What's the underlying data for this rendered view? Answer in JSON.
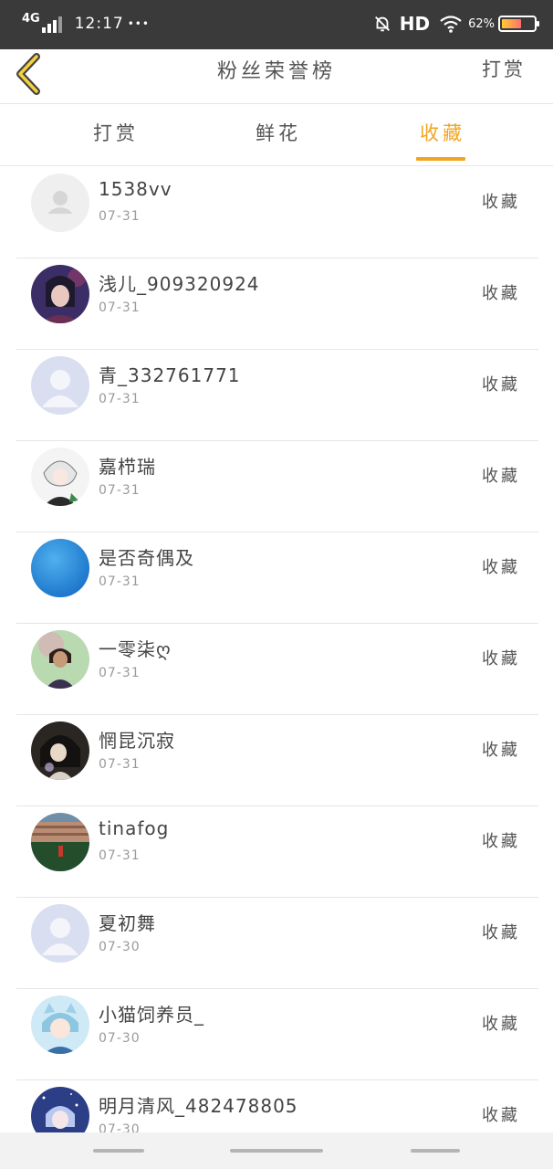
{
  "status_bar": {
    "network": "4G",
    "time": "12:17",
    "dots": "•••",
    "hd_label": "HD",
    "battery_percent": "62%",
    "battery_level": 0.62,
    "icons": [
      "signal-icon",
      "bell-off-icon",
      "wifi-icon",
      "battery-icon"
    ]
  },
  "header": {
    "back_icon": "chevron-left-icon",
    "title": "粉丝荣誉榜",
    "action_label": "打赏"
  },
  "tabs": [
    {
      "label": "打赏",
      "active": false
    },
    {
      "label": "鲜花",
      "active": false
    },
    {
      "label": "收藏",
      "active": true
    }
  ],
  "colors": {
    "accent": "#f0a522",
    "status_bar_bg": "#3a3a3a",
    "text": "#444444",
    "date_text": "#9a9a9a",
    "divider": "#e5e5e5"
  },
  "fans": [
    {
      "name": "1538vv",
      "date": "07-31",
      "tag": "收藏",
      "avatar": "default-gray-avatar"
    },
    {
      "name": "浅儿_909320924",
      "date": "07-31",
      "tag": "收藏",
      "avatar": "anime-girl-purple-avatar"
    },
    {
      "name": "青_332761771",
      "date": "07-31",
      "tag": "收藏",
      "avatar": "default-blue-avatar"
    },
    {
      "name": "嘉栉瑞",
      "date": "07-31",
      "tag": "收藏",
      "avatar": "anime-white-hair-avatar"
    },
    {
      "name": "是否奇偶及",
      "date": "07-31",
      "tag": "收藏",
      "avatar": "blue-circle-avatar"
    },
    {
      "name": "一零柒ღ",
      "date": "07-31",
      "tag": "收藏",
      "avatar": "anime-green-avatar"
    },
    {
      "name": "惘昆沉寂",
      "date": "07-31",
      "tag": "收藏",
      "avatar": "anime-dark-hair-avatar"
    },
    {
      "name": "tinafog",
      "date": "07-31",
      "tag": "收藏",
      "avatar": "building-photo-avatar"
    },
    {
      "name": "夏初舞",
      "date": "07-30",
      "tag": "收藏",
      "avatar": "default-blue-avatar"
    },
    {
      "name": "小猫饲养员_",
      "date": "07-30",
      "tag": "收藏",
      "avatar": "anime-cat-girl-avatar"
    },
    {
      "name": "明月清风_482478805",
      "date": "07-30",
      "tag": "收藏",
      "avatar": "anime-starry-avatar"
    }
  ]
}
